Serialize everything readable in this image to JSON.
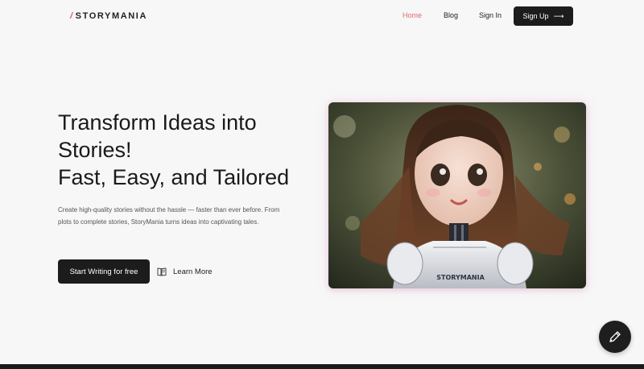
{
  "brand": {
    "logo_text": "STORYMANIA",
    "accent_color": "#e0565c"
  },
  "nav": {
    "items": [
      {
        "label": "Home",
        "active": true
      },
      {
        "label": "Blog"
      },
      {
        "label": "Sign In"
      }
    ],
    "signup_label": "Sign Up",
    "signup_icon": "arrow-right-icon"
  },
  "hero": {
    "title_lines": [
      "Transform Ideas into",
      "Stories!",
      "Fast, Easy, and Tailored"
    ],
    "description": "Create high-quality stories without the hassle — faster than ever before. From plots to complete stories, StoryMania turns ideas into captivating tales.",
    "cta_label": "Start Writing for free",
    "learn_more_label": "Learn More",
    "learn_more_icon": "book-icon",
    "image_caption": "STORYMANIA"
  },
  "fab": {
    "icon": "pencil-icon"
  }
}
